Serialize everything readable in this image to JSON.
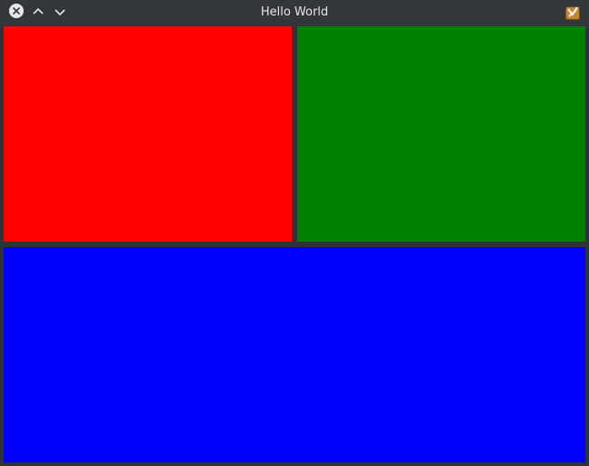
{
  "window": {
    "title": "Hello World"
  },
  "titlebar": {
    "buttons": [
      {
        "name": "close",
        "icon": "close-icon"
      },
      {
        "name": "minimize",
        "icon": "chevron-up-icon"
      },
      {
        "name": "maximize",
        "icon": "chevron-down-icon"
      }
    ],
    "app_icon": "app-icon"
  },
  "panels": [
    {
      "name": "red-panel",
      "color": "#ff0000"
    },
    {
      "name": "green-panel",
      "color": "#008000"
    },
    {
      "name": "blue-panel",
      "color": "#0000ff"
    }
  ]
}
